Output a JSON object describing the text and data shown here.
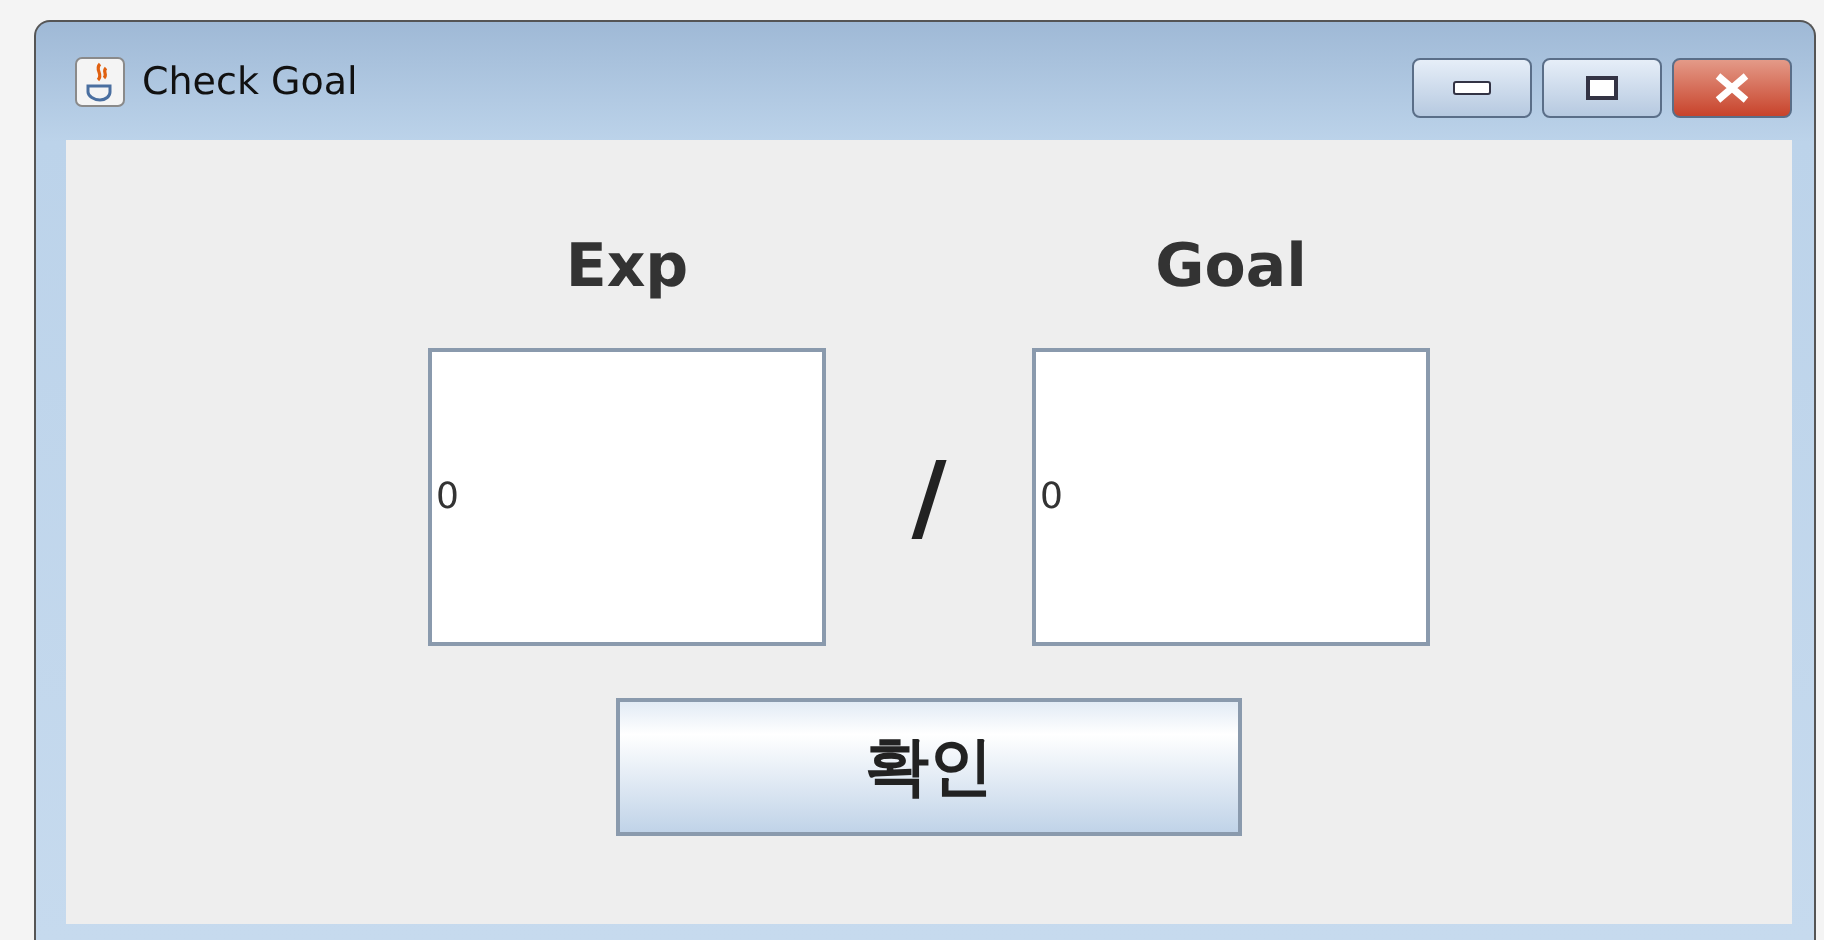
{
  "window": {
    "title": "Check Goal"
  },
  "labels": [
    "Exp",
    "Goal"
  ],
  "fields": [
    {
      "value": "0"
    },
    {
      "value": "0"
    }
  ],
  "separator": "/",
  "button": "확인"
}
